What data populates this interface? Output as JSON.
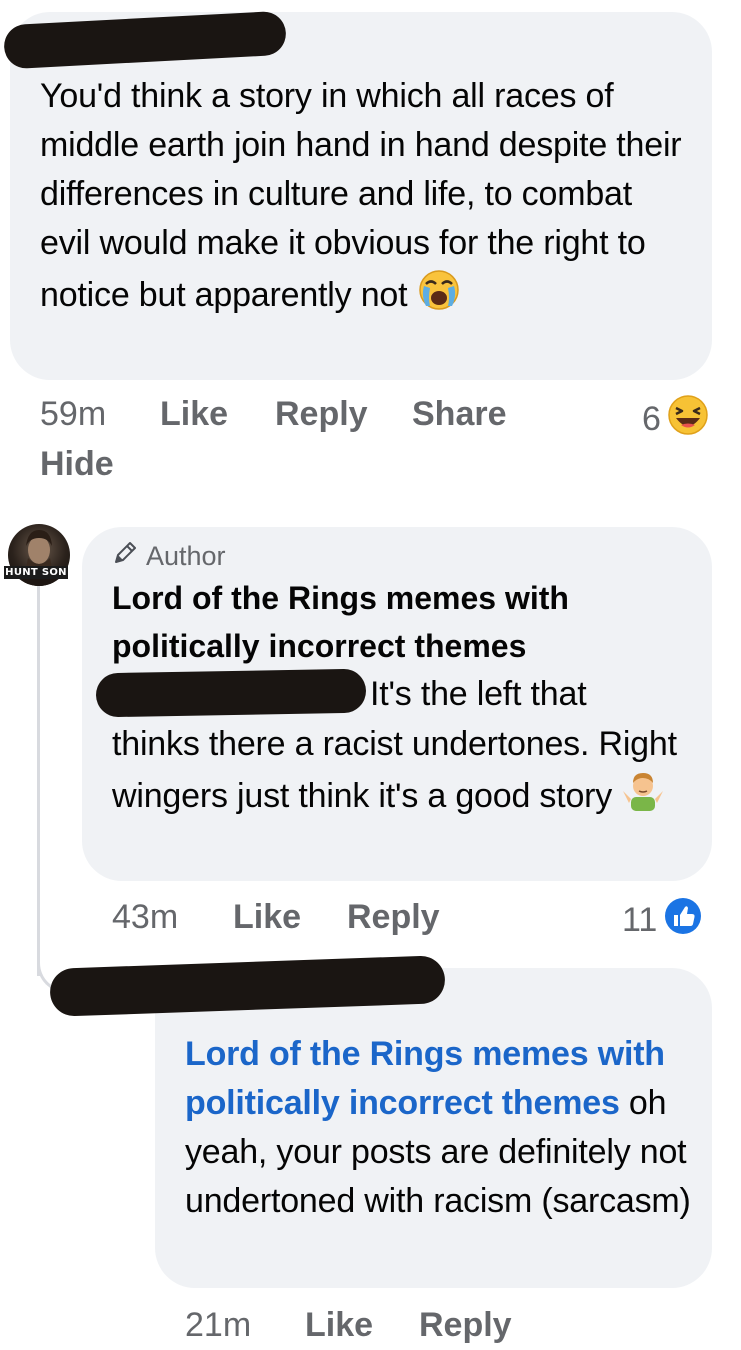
{
  "comment1": {
    "text": "You'd think a story in which all races of middle earth join hand in hand despite their differences in culture and life, to combat evil would make it obvious for the right to notice but apparently not",
    "text_emoji": "crying-face-emoji",
    "time": "59m",
    "like_label": "Like",
    "reply_label": "Reply",
    "share_label": "Share",
    "hide_label": "Hide",
    "reaction_count": "6",
    "reaction_emoji": "haha-reaction"
  },
  "comment2": {
    "avatar_label": "HUNT SON",
    "author_badge": "Author",
    "author_name": "Lord of the Rings memes with politically incorrect themes",
    "text_line1": "It's the left that",
    "text_rest": "thinks there a racist undertones. Right wingers just think it's a good story",
    "text_emoji": "shrug-emoji",
    "time": "43m",
    "like_label": "Like",
    "reply_label": "Reply",
    "reaction_count": "11",
    "reaction_emoji": "like-reaction"
  },
  "comment3": {
    "mention": "Lord of the Rings memes with politically incorrect themes",
    "text": " oh yeah, your posts are definitely not undertoned with racism (sarcasm)",
    "time": "21m",
    "like_label": "Like",
    "reply_label": "Reply"
  }
}
